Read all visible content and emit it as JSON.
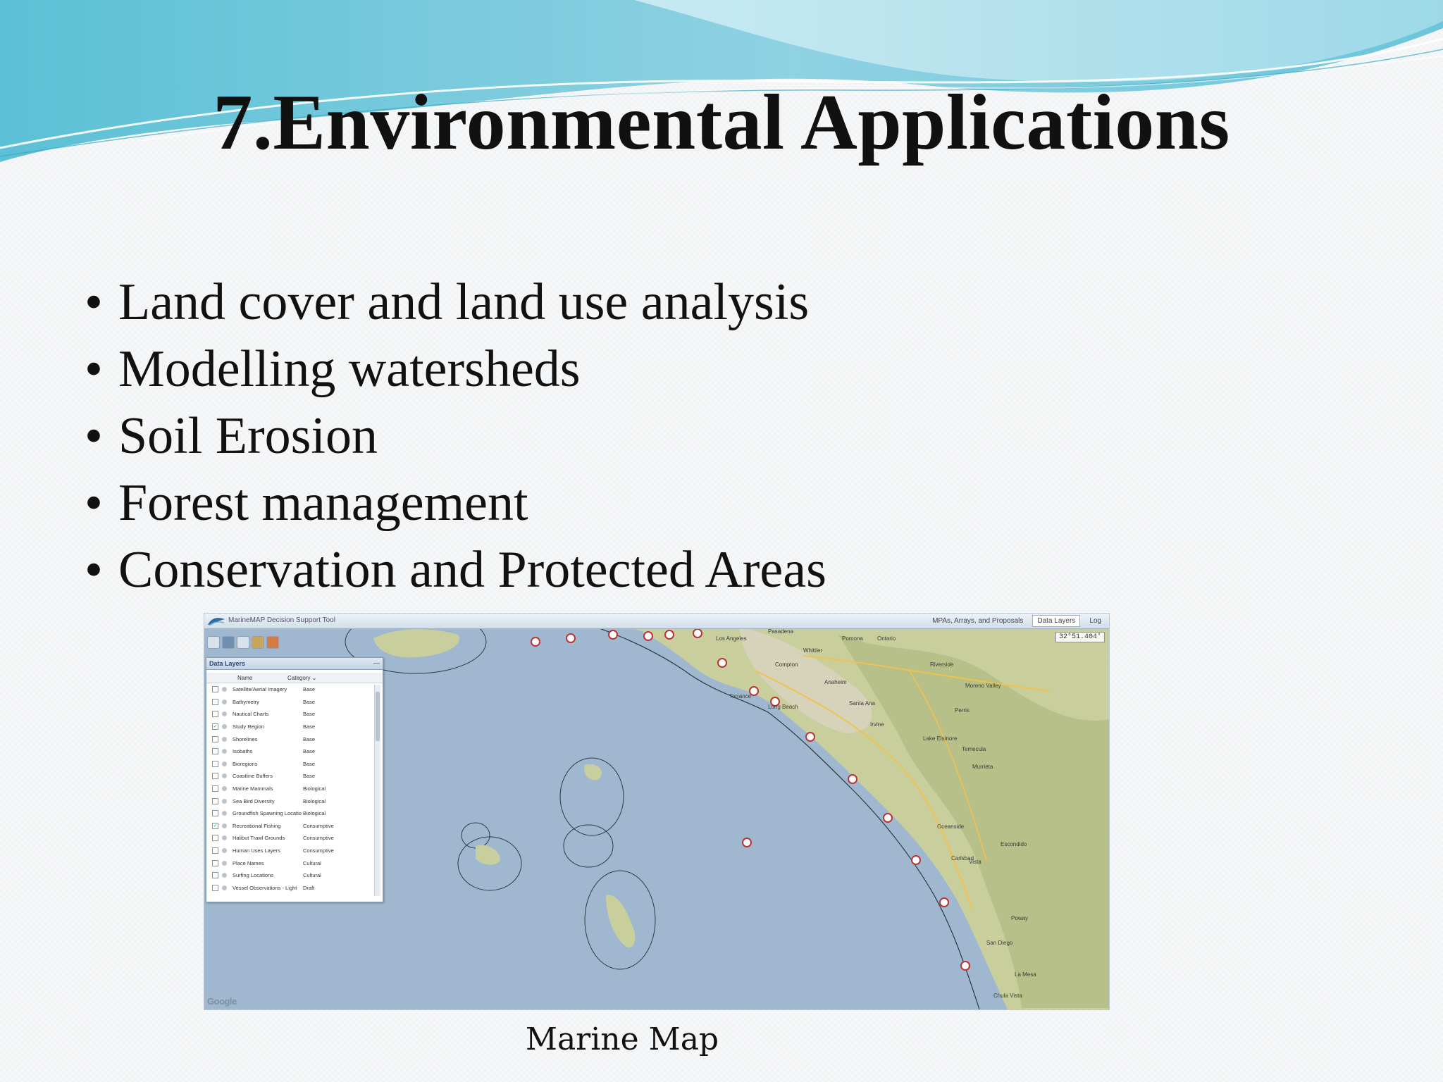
{
  "slide": {
    "title": "7.Environmental Applications",
    "bullet_char": "•",
    "bullets": [
      "Land cover and land use analysis",
      "Modelling watersheds",
      "Soil Erosion",
      "Forest management",
      "Conservation and Protected Areas"
    ],
    "caption": "Marine Map"
  },
  "colors": {
    "title": "#111111",
    "swoosh_dark": "#6fc3d8",
    "swoosh_light": "#bfe7f0",
    "ocean": "#9fb8cf",
    "land": "#c9cf9c"
  },
  "map": {
    "app_title": "MarineMAP Decision Support Tool",
    "tabs": [
      {
        "label": "MPAs, Arrays, and Proposals",
        "active": false
      },
      {
        "label": "Data Layers",
        "active": true
      },
      {
        "label": "Log",
        "active": false
      }
    ],
    "coord_readout": "32°51.404'",
    "panel": {
      "title": "Data Layers",
      "close": "—",
      "col_name": "Name",
      "col_category": "Category ⌄",
      "layers": [
        {
          "name": "Satellite/Aerial Imagery",
          "category": "Base",
          "checked": false
        },
        {
          "name": "Bathymetry",
          "category": "Base",
          "checked": false
        },
        {
          "name": "Nautical Charts",
          "category": "Base",
          "checked": false
        },
        {
          "name": "Study Region",
          "category": "Base",
          "checked": true
        },
        {
          "name": "Shorelines",
          "category": "Base",
          "checked": false
        },
        {
          "name": "Isobaths",
          "category": "Base",
          "checked": false
        },
        {
          "name": "Bioregions",
          "category": "Base",
          "checked": false
        },
        {
          "name": "Coastline Buffers",
          "category": "Base",
          "checked": false
        },
        {
          "name": "Marine Mammals",
          "category": "Biological",
          "checked": false
        },
        {
          "name": "Sea Bird Diversity",
          "category": "Biological",
          "checked": false
        },
        {
          "name": "Groundfish Spawning Locatio",
          "category": "Biological",
          "checked": false
        },
        {
          "name": "Recreational Fishing",
          "category": "Consumptive",
          "checked": true
        },
        {
          "name": "Halibut Trawl Grounds",
          "category": "Consumptive",
          "checked": false
        },
        {
          "name": "Human Uses Layers",
          "category": "Consumptive",
          "checked": false
        },
        {
          "name": "Place Names",
          "category": "Cultural",
          "checked": false
        },
        {
          "name": "Surfing Locations",
          "category": "Cultural",
          "checked": false
        },
        {
          "name": "Vessel Observations - Light",
          "category": "Draft",
          "checked": false
        }
      ]
    },
    "place_labels": [
      "Los Angeles",
      "Pasadena",
      "Pomona",
      "Ontario",
      "Riverside",
      "Anaheim",
      "Santa Ana",
      "Irvine",
      "Long Beach",
      "Torrance",
      "Compton",
      "Whittier",
      "Temecula",
      "Murrieta",
      "Escondido",
      "San Diego",
      "Oceanside",
      "Carlsbad",
      "Poway",
      "Vista",
      "La Mesa",
      "Chula Vista",
      "Lake Elsinore",
      "Perris",
      "Moreno Valley"
    ],
    "google_logo": "Google"
  }
}
